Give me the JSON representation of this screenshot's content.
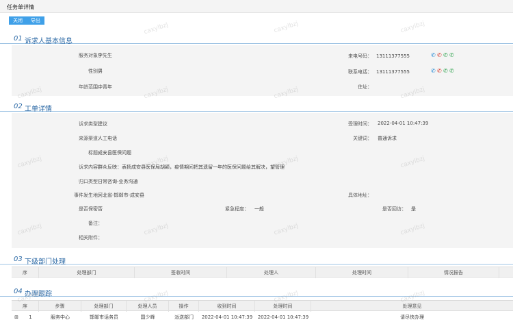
{
  "window": {
    "title": "任务单详情"
  },
  "toolbar": {
    "close_label": "关闭",
    "export_label": "导出"
  },
  "sections": {
    "s1": {
      "num": "01",
      "title": "诉求人基本信息"
    },
    "s2": {
      "num": "02",
      "title": "工单详情"
    },
    "s3": {
      "num": "03",
      "title": "下级部门处理"
    },
    "s4": {
      "num": "04",
      "title": "办理跟踪"
    }
  },
  "petitioner": {
    "service_target_label": "服务对象：",
    "service_target": "李先生",
    "gender_label": "性别：",
    "gender": "男",
    "age_label": "年龄范围：",
    "age": "中青年",
    "incoming_phone_label": "来电号码：",
    "incoming_phone": "13111377555",
    "contact_phone_label": "联系电话：",
    "contact_phone": "13111377555",
    "address_label": "住址：",
    "address": ""
  },
  "order": {
    "type_label": "诉求类型：",
    "type": "建议",
    "source_label": "来源渠道：",
    "source": "人工电话",
    "subject_label": "标题：",
    "subject": "成安县医保问题",
    "content_label": "诉求内容：",
    "content": "群众反映：表扬成安县医保局胡颖，疫情期间把其遗留一年的医保问题给其解决，望管理",
    "category_label": "归口类型：",
    "category": "日常咨询-业务沟通",
    "location_label": "事件发生地：",
    "location": "河北省-邯郸市-成安县",
    "secret_label": "是否保密：",
    "secret": "否",
    "accept_time_label": "受理时间：",
    "accept_time": "2022-04-01 10:47:39",
    "keyword_label": "关键词：",
    "keyword": "普通诉求",
    "specific_address_label": "具体地址：",
    "specific_address": "",
    "urgency_label": "紧急程度：",
    "urgency": "一般",
    "reply_label": "是否回访：",
    "reply": "是",
    "note_label": "备注：",
    "note": "",
    "attachment_label": "相关附件：",
    "attachment": ""
  },
  "sub_table": {
    "headers": [
      "序",
      "处理部门",
      "签收时间",
      "处理人",
      "处理时间",
      "情况报告"
    ]
  },
  "track_table": {
    "headers": [
      "序",
      "步骤",
      "处理部门",
      "处理人员",
      "操作",
      "收到时间",
      "处理时间",
      "处理意见"
    ],
    "rows": [
      {
        "no": "1",
        "step": "服务中心",
        "dept": "邯郸市话务员",
        "person": "国少峰",
        "op": "派送部门",
        "recv": "2022-04-01 10:47:39",
        "done": "2022-04-01 10:47:39",
        "opinion": "请尽快办理"
      }
    ]
  },
  "watermark": {
    "text": "caxylbzj"
  }
}
